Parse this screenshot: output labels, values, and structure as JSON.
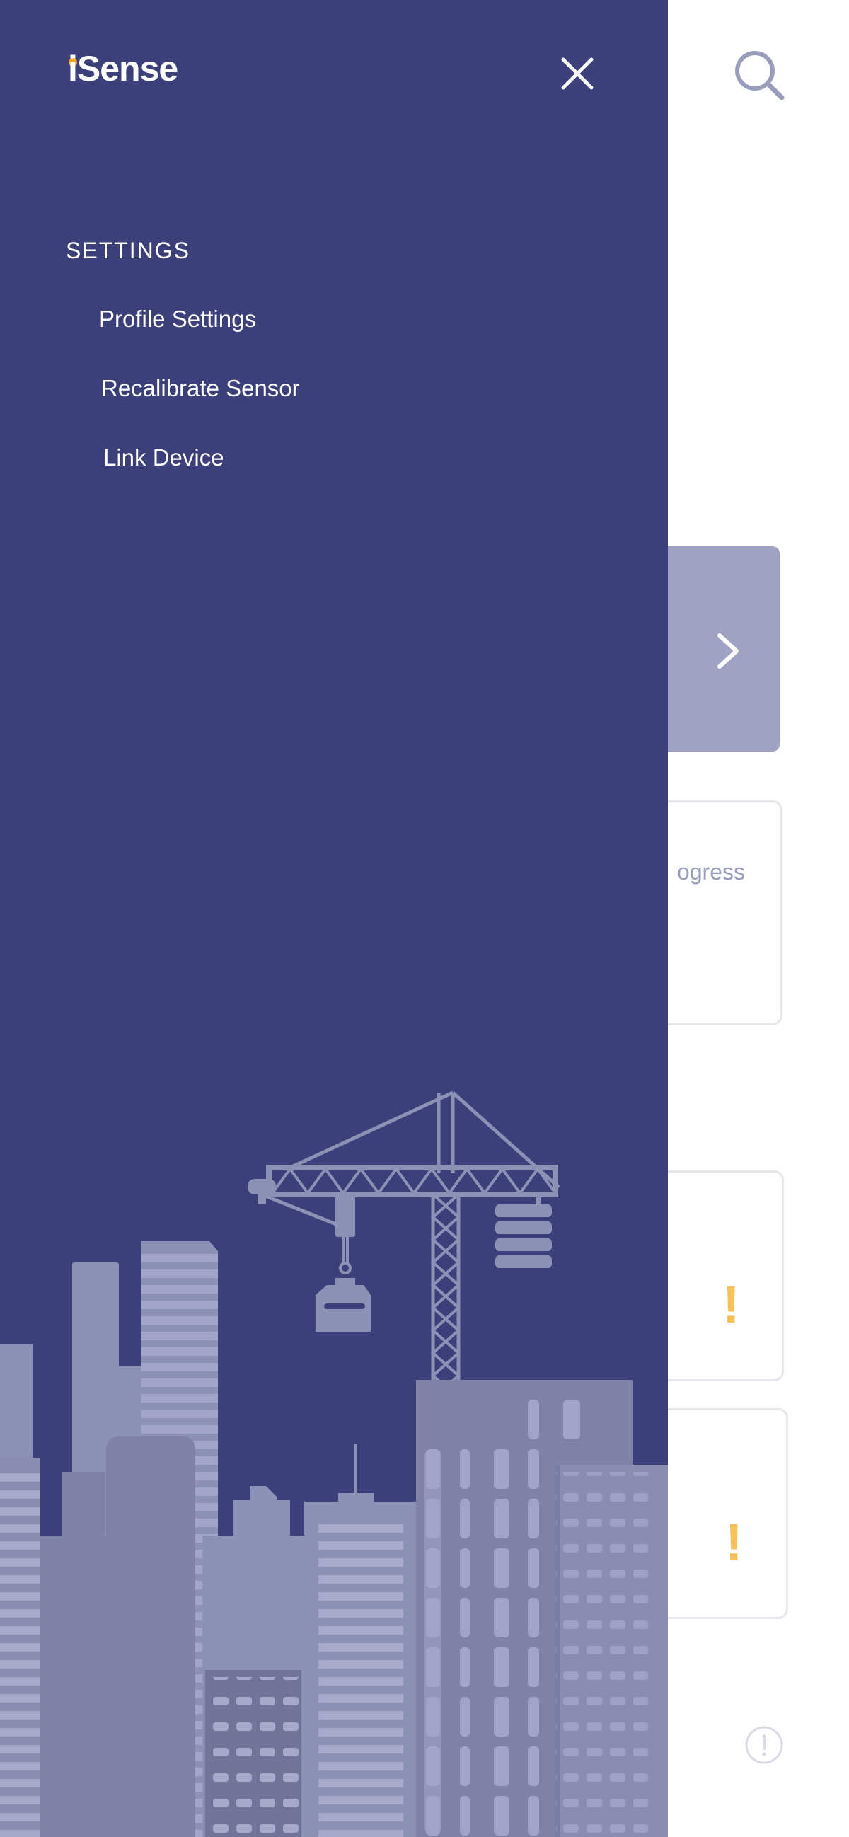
{
  "app": {
    "logo_text": "iSense",
    "brand_color": "#3b3f7a",
    "accent_color": "#f7a81c"
  },
  "drawer": {
    "close_icon": "close-icon",
    "section_title": "SETTINGS",
    "items": [
      {
        "label": "Profile Settings"
      },
      {
        "label": "Recalibrate Sensor"
      },
      {
        "label": "Link Device"
      }
    ],
    "illustration": "city-construction-illustration"
  },
  "background": {
    "search_icon": "search-icon",
    "progress_text": "ogress",
    "alert_mark": "!",
    "info_icon": "info-icon"
  }
}
